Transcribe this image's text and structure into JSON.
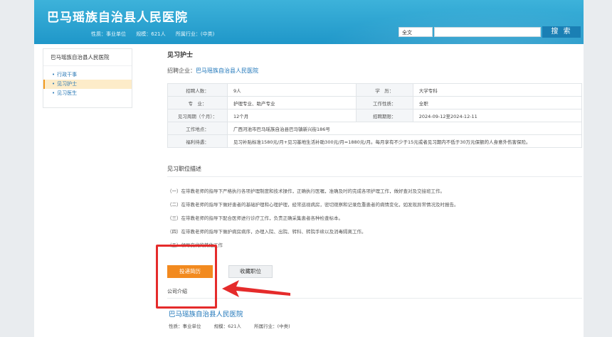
{
  "header": {
    "site_name": "巴马瑶族自治县人民医院",
    "meta": [
      "性质：事业单位",
      "规模：621人",
      "所属行业：(中类)"
    ],
    "search_scope": "全文",
    "search_placeholder": "",
    "search_button": "搜 索"
  },
  "sidebar": {
    "title": "巴马瑶族自治县人民医院",
    "items": [
      {
        "label": "行政干事",
        "active": false
      },
      {
        "label": "见习护士",
        "active": true
      },
      {
        "label": "见习医生",
        "active": false
      }
    ]
  },
  "job": {
    "title": "见习护士",
    "employer_label": "招聘企业：",
    "employer_name": "巴马瑶族自治县人民医院",
    "table": {
      "row1": {
        "l1": "招聘人数：",
        "v1": "9人",
        "l2": "学　历：",
        "v2": "大学专科"
      },
      "row2": {
        "l1": "专　业：",
        "v1": "护理专业、助产专业",
        "l2": "工作性质：",
        "v2": "全职"
      },
      "row3": {
        "l1": "见习周期（个月）：",
        "v1": "12个月",
        "l2": "招聘期限：",
        "v2": "2024-09-12至2024-12-11"
      },
      "row4": {
        "l1": "工作地点：",
        "v1": "广西河池市巴马瑶族自治县巴马镇新兴街186号"
      },
      "row5": {
        "l1": "福利待遇：",
        "v1": "见习补贴标准1580元/月+见习基地生活补助300元/月=1880元/月。每月享有不少于15元或者见习期内不低于30万元保额的人身意外伤害保险。"
      }
    },
    "section_title": "见习职位描述",
    "duties": [
      "（一）在带教老师的指导下严格执行各项护理制度和技术操作，正确执行医嘱，准确及时的完成各项护理工作，做好查对及交接班工作。",
      "（二）在带教老师的指导下做好患者的基础护理和心理护理，经常巡视病房，密切观察和记录危重患者的病情变化，如发现异常情况及时报告。",
      "（三）在带教老师的指导下配合医师进行诊疗工作，负责正确采集患者各种检查标本。",
      "（四）在带教老师的指导下做护病房病序，办理入院、出院、转科、转院手续以及消毒隔离工作。",
      "（五）领导交代的其他工作"
    ],
    "apply_button": "投递简历",
    "favorite_button": "收藏职位",
    "company_tab": "公司介绍",
    "company_name": "巴马瑶族自治县人民医院",
    "company_meta": [
      "性质：事业单位",
      "规模：621人",
      "所属行业：(中类)"
    ]
  },
  "colors": {
    "header_blue": "#1f97c9",
    "link_blue": "#1a73b8",
    "apply_orange": "#f28a1f",
    "annotation_red": "#e52b2b"
  }
}
